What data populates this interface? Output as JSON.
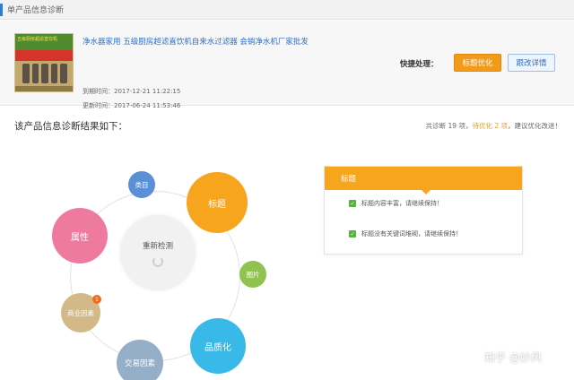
{
  "header": {
    "title": "单产品信息诊断"
  },
  "product": {
    "image_caption": "五级厨房超滤直饮机",
    "name": "净水器家用  五级厨房超滤直饮机自来水过滤器  会销净水机厂家批发",
    "expire_time": "到期时间：2017-12-21 11:22:15",
    "update_time": "更新时间：2017-06-24 11:53:46"
  },
  "actions": {
    "quick_label": "快捷处理：",
    "optimize_label": "标题优化",
    "track_label": "跟改详情"
  },
  "result": {
    "title": "该产品信息诊断结果如下：",
    "summary_prefix": "共诊断 19 项，",
    "summary_highlight": "待优化 2 项",
    "summary_suffix": "，建议优化改进！"
  },
  "diagram": {
    "center_label": "重新检测",
    "nodes": {
      "category": "类目",
      "title": "标题",
      "attributes": "属性",
      "image": "图片",
      "business": "商业因素",
      "quality": "品质化",
      "trade": "交易因素"
    },
    "business_badge": "1",
    "colors": {
      "category": "#5b8fd6",
      "title": "#f8a51e",
      "attributes": "#ef7a9f",
      "image": "#8fc24f",
      "business": "#d3b987",
      "quality": "#39b9e8",
      "trade": "#95afc9"
    }
  },
  "detail": {
    "heading": "标题",
    "checks": [
      "标题内容丰富，请继续保持！",
      "标题没有关键词堆砌，请继续保持！"
    ]
  },
  "watermark": "知乎 @妙风"
}
